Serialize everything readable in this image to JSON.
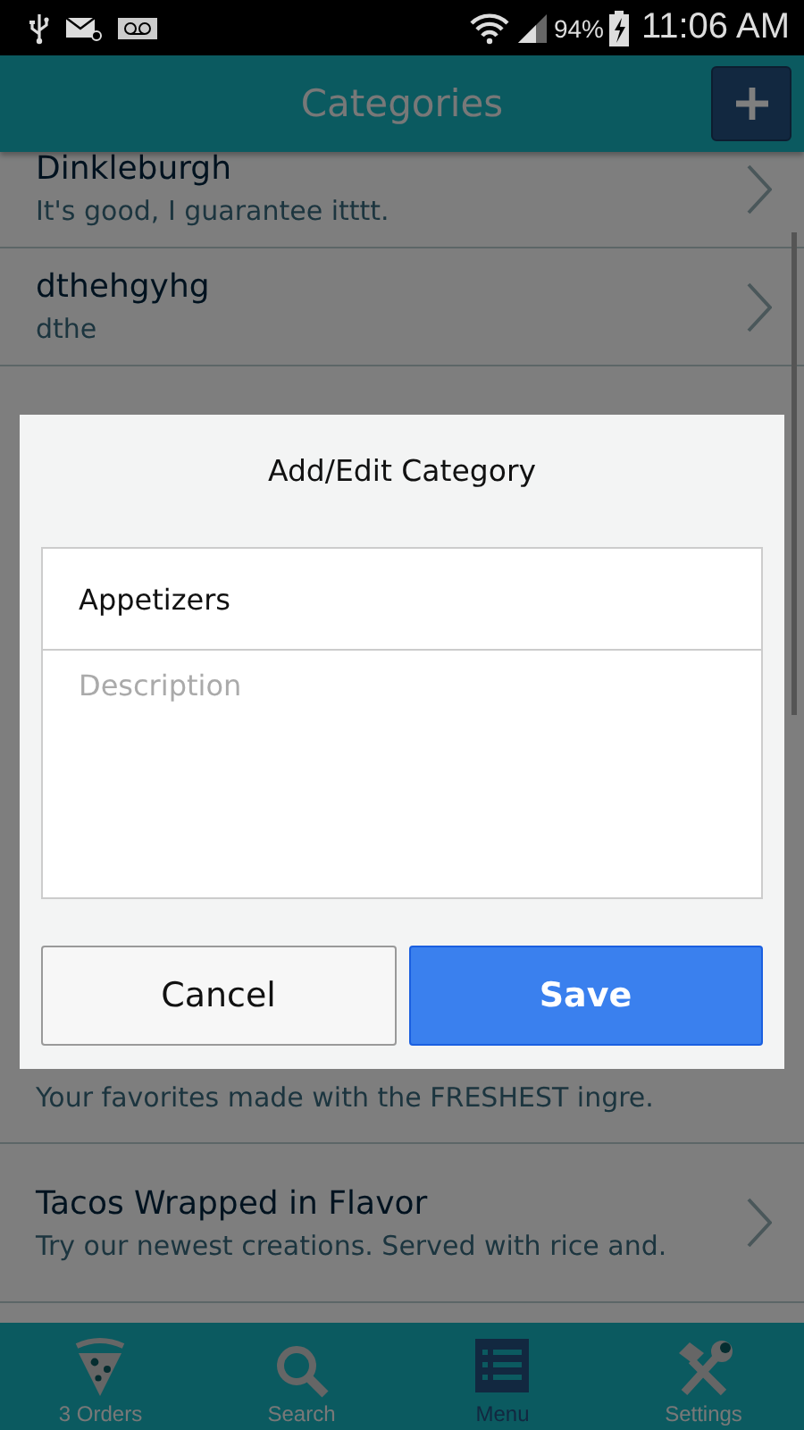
{
  "status_bar": {
    "battery": "94%",
    "time": "11:06 AM"
  },
  "header": {
    "title": "Categories"
  },
  "categories": [
    {
      "title": "Dinkleburgh",
      "subtitle": "It's good, I guarantee itttt."
    },
    {
      "title": "dthehgyhg",
      "subtitle": "dthe"
    },
    {
      "subtitle": "Your favorites made with the FRESHEST ingre."
    },
    {
      "title": "Tacos Wrapped in Flavor",
      "subtitle": "Try our newest creations. Served with rice and."
    }
  ],
  "dialog": {
    "title": "Add/Edit Category",
    "name_value": "Appetizers",
    "description_placeholder": "Description",
    "buttons": [
      {
        "label": "Cancel",
        "kind": "secondary"
      },
      {
        "label": "Save",
        "kind": "primary"
      }
    ]
  },
  "bottom_nav": [
    {
      "label": "3 Orders",
      "selected": false
    },
    {
      "label": "Search",
      "selected": false
    },
    {
      "label": "Menu",
      "selected": true
    },
    {
      "label": "Settings",
      "selected": false
    }
  ]
}
